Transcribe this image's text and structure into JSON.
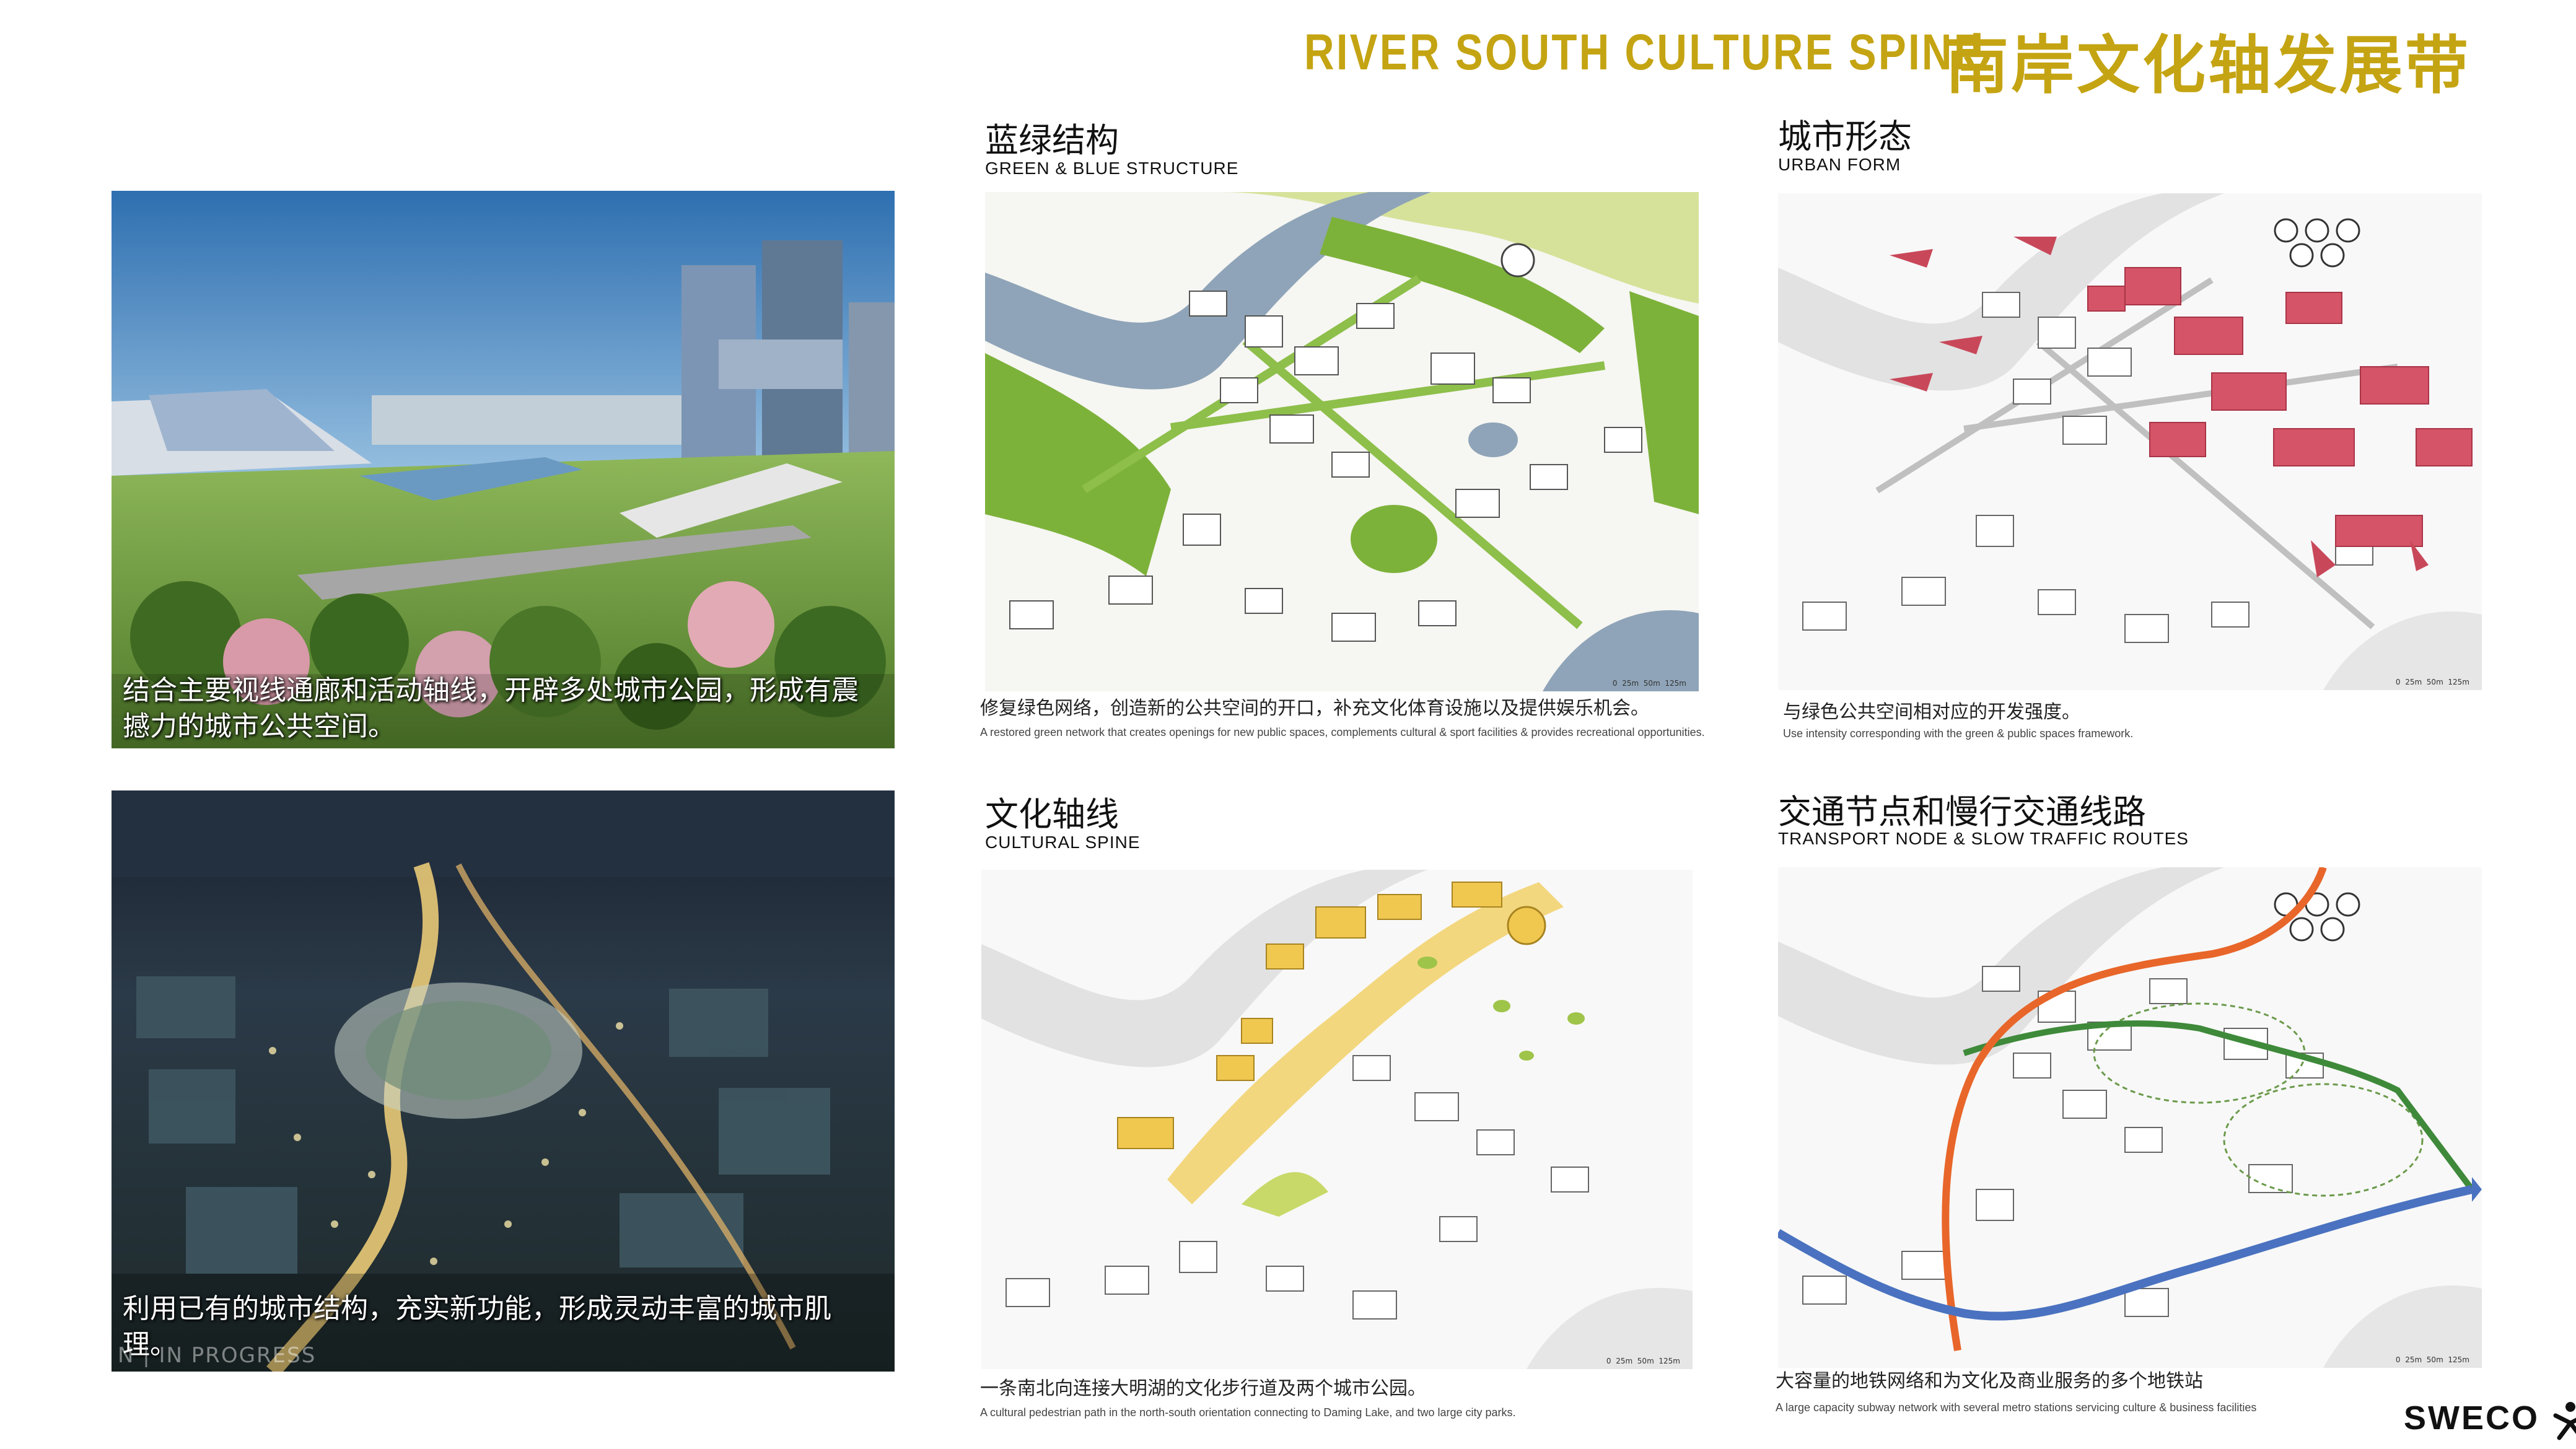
{
  "header": {
    "title_en": "RIVER SOUTH CULTURE SPINE",
    "title_cn": "南岸文化轴发展带"
  },
  "photos": [
    {
      "caption": "结合主要视线通廊和活动轴线，开辟多处城市公园，形成有震撼力的城市公共空间。"
    },
    {
      "caption": "利用已有的城市结构，充实新功能，形成灵动丰富的城市肌理。",
      "watermark": "N | IN PROGRESS"
    }
  ],
  "panels": {
    "green_blue": {
      "title_cn": "蓝绿结构",
      "title_en": "GREEN & BLUE STRUCTURE",
      "caption_cn": "修复绿色网络，创造新的公共空间的开口，补充文化体育设施以及提供娱乐机会。",
      "caption_en": "A restored green network that creates openings for new public spaces, complements cultural & sport facilities & provides recreational opportunities."
    },
    "urban_form": {
      "title_cn": "城市形态",
      "title_en": "URBAN FORM",
      "caption_cn": "与绿色公共空间相对应的开发强度。",
      "caption_en": "Use intensity corresponding with the green & public spaces framework."
    },
    "cultural_spine": {
      "title_cn": "文化轴线",
      "title_en": "CULTURAL SPINE",
      "caption_cn": "一条南北向连接大明湖的文化步行道及两个城市公园。",
      "caption_en": "A cultural pedestrian path in the north-south orientation connecting to Daming Lake, and two large city parks."
    },
    "transport": {
      "title_cn": "交通节点和慢行交通线路",
      "title_en": "TRANSPORT NODE & SLOW TRAFFIC ROUTES",
      "caption_cn": "大容量的地铁网络和为文化及商业服务的多个地铁站",
      "caption_en": "A large capacity subway network with several metro stations servicing culture & business facilities"
    }
  },
  "scale_labels": [
    "0",
    "25m",
    "50m",
    "125m"
  ],
  "logo": {
    "text": "SWECO"
  },
  "colors": {
    "accent": "#c4a412",
    "green": "#7db23a",
    "water": "#8fa4b8",
    "red": "#c8485a",
    "orange": "#e8662a",
    "blue": "#4a72c0",
    "yellow": "#f0c850"
  }
}
